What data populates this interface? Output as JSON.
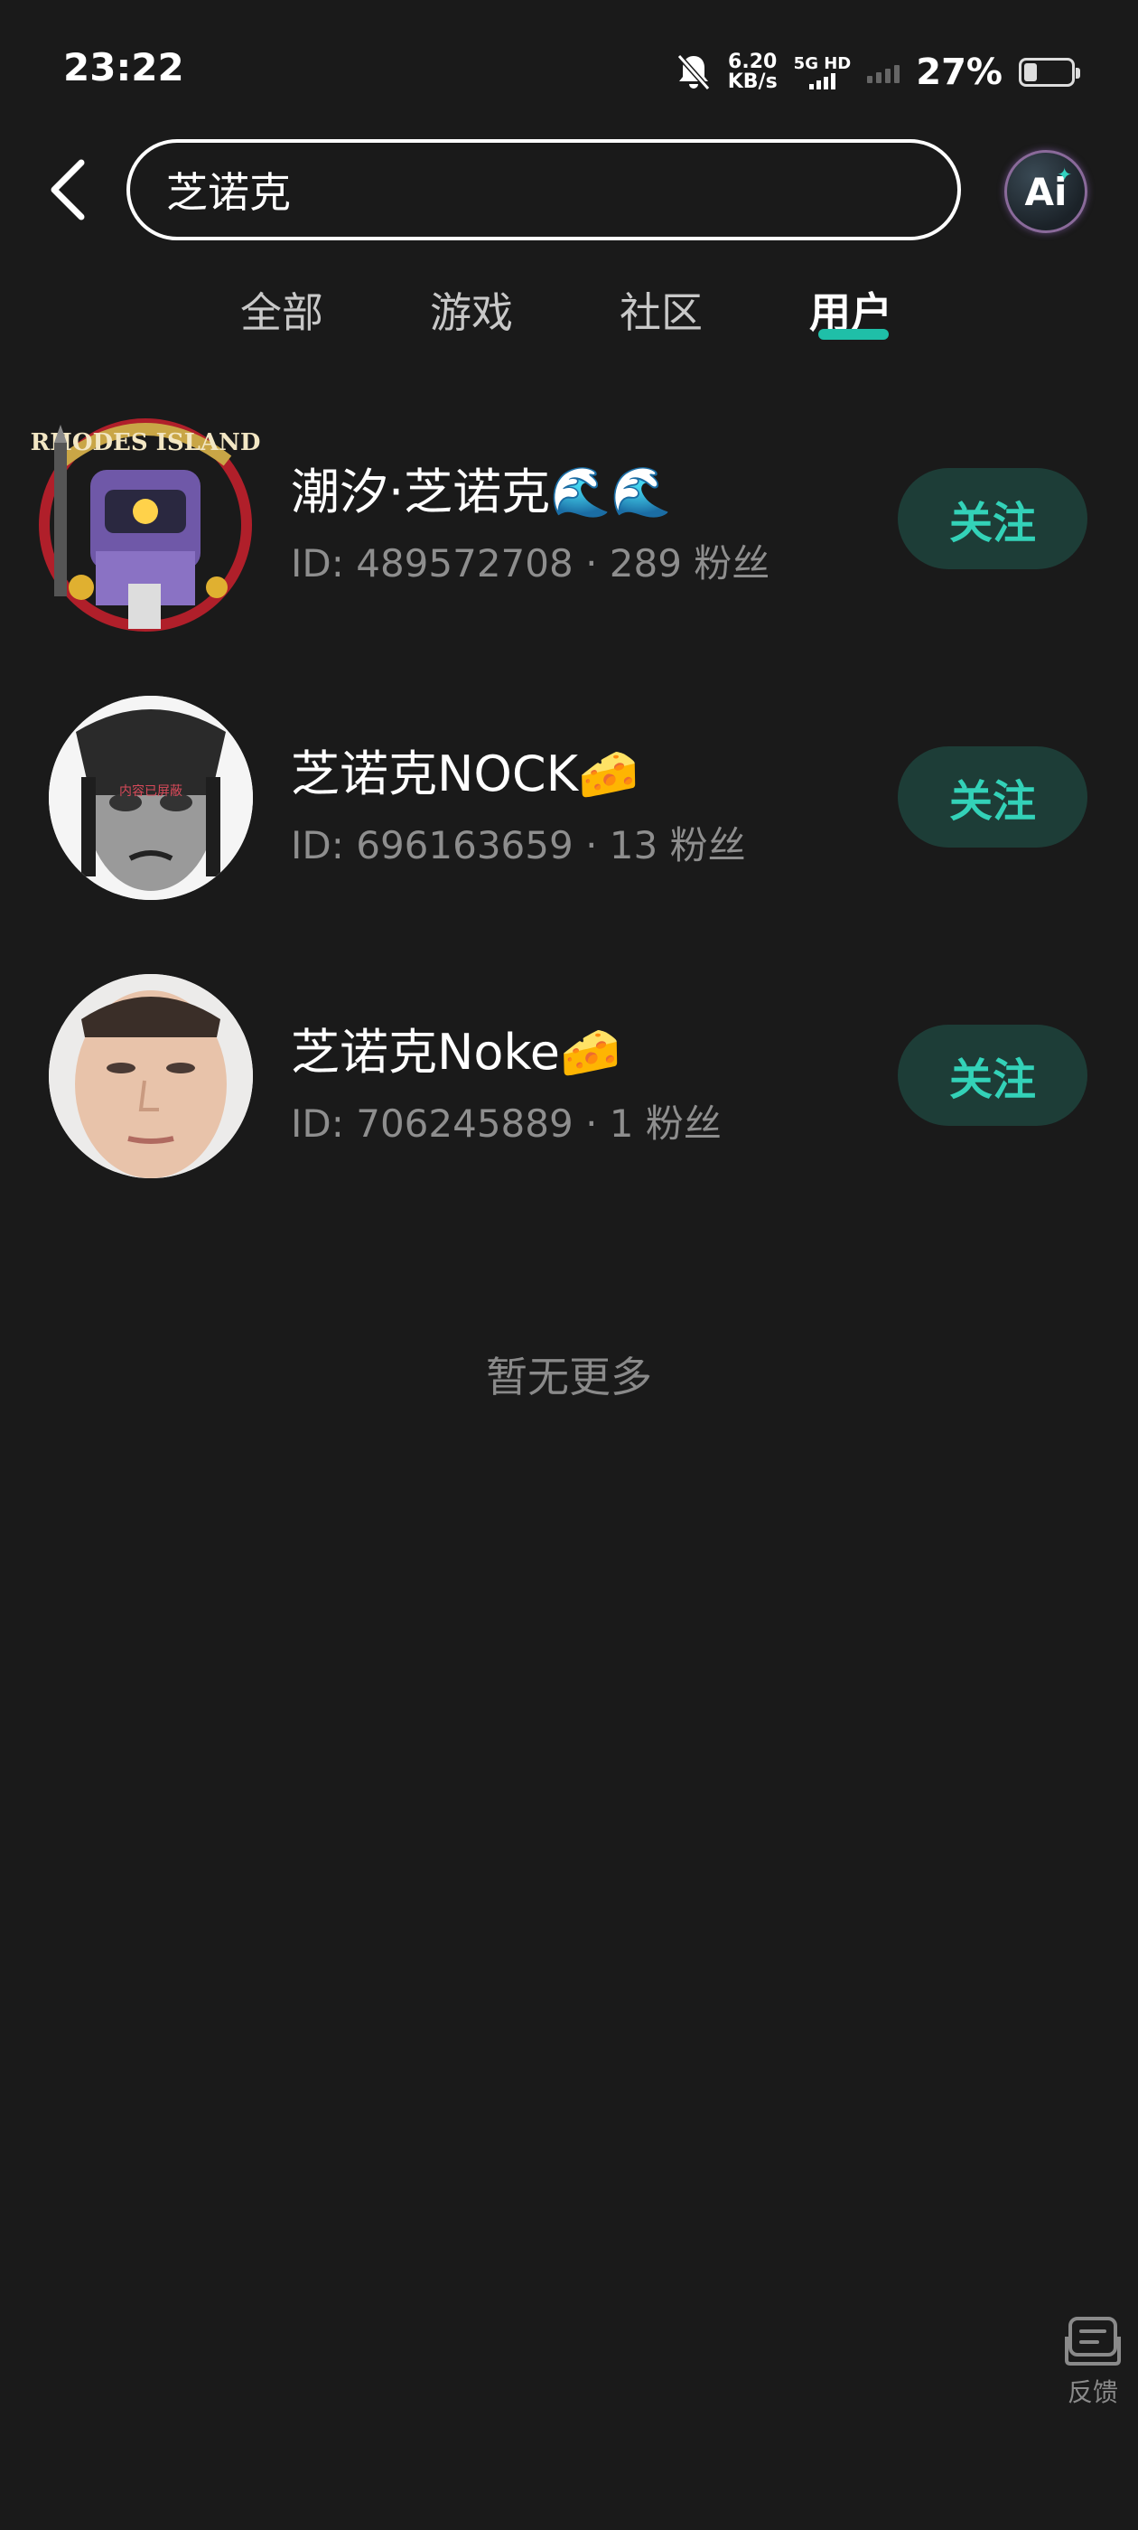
{
  "status_bar": {
    "time": "23:22",
    "net_speed_value": "6.20",
    "net_speed_unit": "KB/s",
    "network_type": "5G HD",
    "battery_percent": "27%"
  },
  "search": {
    "query": "芝诺克",
    "ai_button_label": "Ai"
  },
  "tabs": [
    {
      "label": "全部",
      "active": false
    },
    {
      "label": "游戏",
      "active": false
    },
    {
      "label": "社区",
      "active": false
    },
    {
      "label": "用户",
      "active": true
    }
  ],
  "users": [
    {
      "name": "潮汐·芝诺克🌊🌊",
      "meta": "ID: 489572708 · 289 粉丝",
      "follow_label": "关注",
      "avatar": "rhodes-island-robot-avatar"
    },
    {
      "name": "芝诺克NOCK🧀",
      "meta": "ID: 696163659 · 13 粉丝",
      "follow_label": "关注",
      "avatar": "grayscale-face-avatar"
    },
    {
      "name": "芝诺克Noke🧀",
      "meta": "ID: 706245889 · 1 粉丝",
      "follow_label": "关注",
      "avatar": "face-photo-avatar"
    }
  ],
  "no_more_text": "暂无更多",
  "feedback_label": "反馈",
  "colors": {
    "background": "#1a1a1a",
    "accent": "#1fbfa8",
    "follow_bg": "#1d3d37",
    "follow_text": "#33d2b8"
  }
}
